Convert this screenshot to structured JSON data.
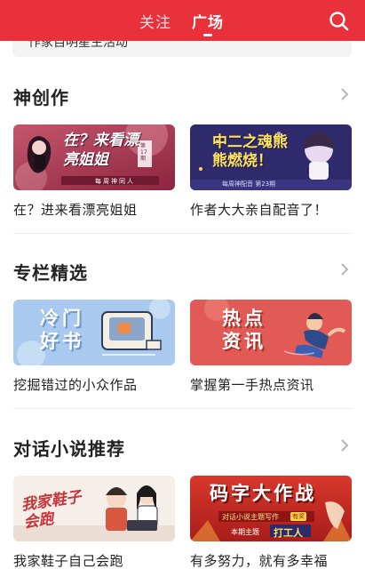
{
  "header": {
    "tabs": [
      {
        "label": "关注",
        "active": false
      },
      {
        "label": "广场",
        "active": true
      }
    ],
    "search_icon": "search-icon",
    "background_color": "#e8313a"
  },
  "peek_item": {
    "text": "作家自明星主活动"
  },
  "sections": [
    {
      "title": "神创作",
      "more_icon": "chevron-right-icon",
      "cards": [
        {
          "thumb_text": "在？来看漂亮姐姐",
          "thumb_sub": "每周神同人",
          "thumb_badge": "第17期",
          "caption": "在？进来看漂亮姐姐"
        },
        {
          "thumb_text": "中二之魂熊熊燃烧！",
          "thumb_sub": "每周神配音 第23期",
          "caption": "作者大大亲自配音了！"
        }
      ]
    },
    {
      "title": "专栏精选",
      "more_icon": "chevron-right-icon",
      "cards": [
        {
          "thumb_text": "冷门好书",
          "caption": "挖掘错过的小众作品"
        },
        {
          "thumb_text": "热点资讯",
          "caption": "掌握第一手热点资讯"
        }
      ]
    },
    {
      "title": "对话小说推荐",
      "more_icon": "chevron-right-icon",
      "cards": [
        {
          "thumb_text": "我家鞋子会跑",
          "caption": "我家鞋子自己会跑"
        },
        {
          "thumb_text": "码字大作战",
          "thumb_sub": "对话小说主题写作",
          "thumb_sub2": "本期主题",
          "thumb_theme": "打工人",
          "thumb_badge": "有奖",
          "caption": "有多努力，就有多幸福"
        }
      ]
    }
  ]
}
